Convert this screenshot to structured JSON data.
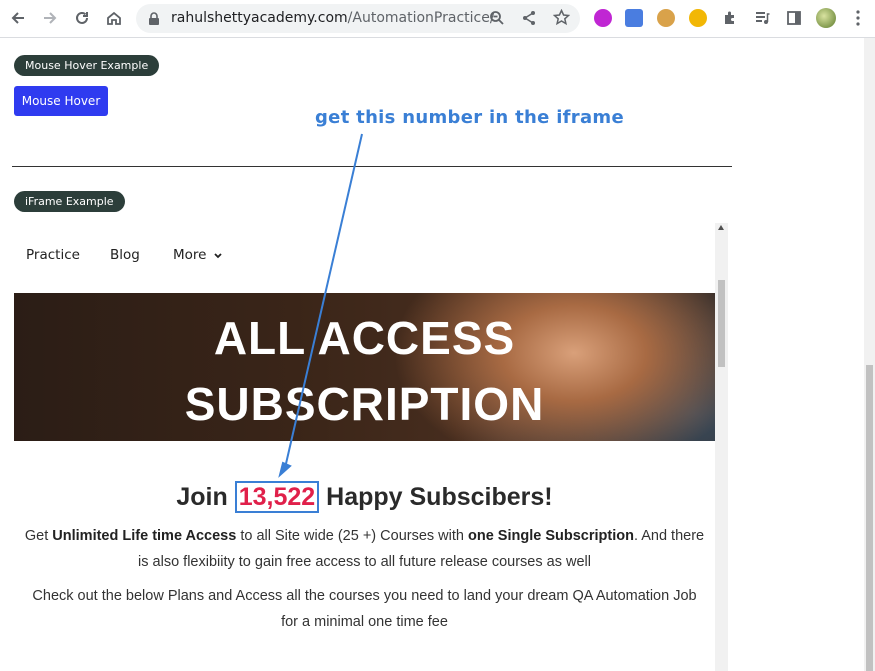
{
  "browser": {
    "url_host": "rahulshettyacademy.com",
    "url_path": "/AutomationPractice/",
    "back_icon": "back-arrow-icon",
    "forward_icon": "forward-arrow-icon",
    "reload_icon": "reload-icon",
    "home_icon": "home-icon"
  },
  "sections": {
    "mouse_hover_label": "Mouse Hover Example",
    "mouse_hover_button": "Mouse Hover",
    "iframe_label": "iFrame Example"
  },
  "annotation": {
    "text": "get this number in the iframe",
    "color": "#3a7fd5"
  },
  "iframe": {
    "nav": {
      "practice": "Practice",
      "blog": "Blog",
      "more": "More"
    },
    "hero_line1": "ALL ACCESS",
    "hero_line2": "SUBSCRIPTION",
    "join_prefix": "Join",
    "subscriber_count": "13,522",
    "join_suffix": "Happy Subscibers!",
    "para1": {
      "t1": "Get ",
      "b1": "Unlimited Life time Access",
      "t2": " to all Site wide (25 +) Courses with ",
      "b2": "one Single Subscription",
      "t3": ". And there is also flexibiity to gain free access to all future release courses as well"
    },
    "para2": "Check out the below Plans and Access all the courses you need to land your dream QA Automation Job for a minimal one time fee"
  },
  "colors": {
    "pill_bg": "#2c3e3a",
    "button_bg": "#2f3bf0",
    "highlight": "#e0204a"
  }
}
